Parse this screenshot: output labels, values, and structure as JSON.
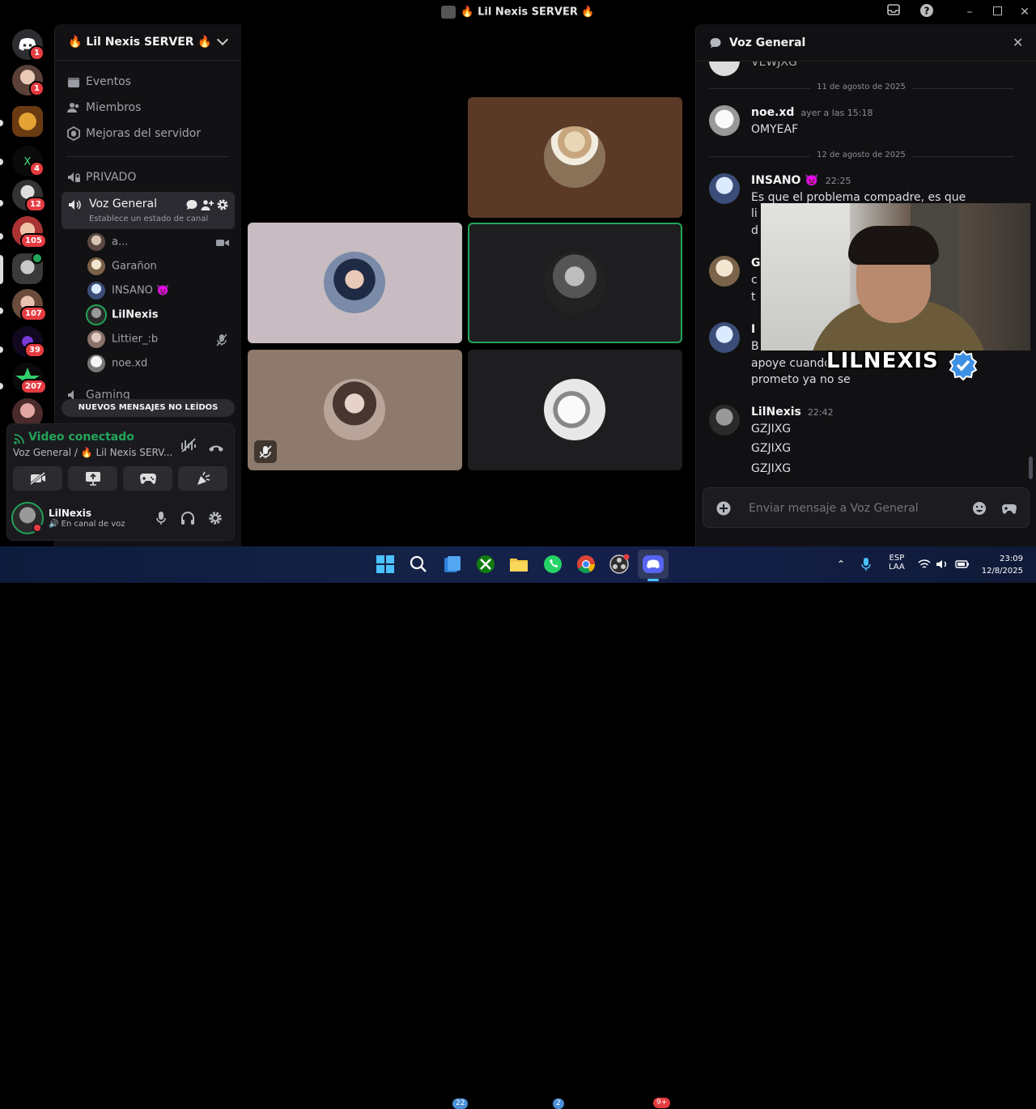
{
  "window": {
    "title": "🔥 Lil Nexis SERVER 🔥"
  },
  "rail": {
    "badges": [
      "1",
      "1",
      "4",
      "12",
      "105",
      "107",
      "39",
      "207"
    ]
  },
  "server": {
    "name": "🔥 Lil Nexis SERVER 🔥",
    "nav": [
      "Eventos",
      "Miembros",
      "Mejoras del servidor"
    ],
    "category": "PRIVADO",
    "voice_channel": {
      "name": "Voz General",
      "status": "Establece un estado de canal"
    },
    "members": [
      "a...",
      "Garañon",
      "INSANO 👿",
      "LilNexis",
      "Littier_:b",
      "noe.xd"
    ],
    "next_channel": "Gaming",
    "unread_banner": "NUEVOS MENSAJES NO LEÍDOS"
  },
  "voice": {
    "status": "Video conectado",
    "location": "Voz General / 🔥 Lil Nexis SERV..."
  },
  "user": {
    "name": "LilNexis",
    "status": "En canal de voz"
  },
  "chat": {
    "title": "Voz General",
    "truncated_top": "VEWJXG",
    "date1": "11 de agosto de 2025",
    "msg1": {
      "author": "noe.xd",
      "time": "ayer a las 15:18",
      "text": "OMYEAF"
    },
    "date2": "12 de agosto de 2025",
    "msg2": {
      "author": "INSANO 👿",
      "time": "22:25",
      "line1": "Es que el problema compadre, es que",
      "line2": "li",
      "line3": "d"
    },
    "msg3": {
      "author": "G",
      "line1": "c",
      "line2": "t"
    },
    "msg4": {
      "author": "I",
      "line1": "B",
      "line2": "apoye cuando",
      "line3": "prometo ya no se"
    },
    "msg5": {
      "author": "LilNexis",
      "time": "22:42",
      "lines": [
        "GZJIXG",
        "GZJIXG",
        "GZJIXG"
      ]
    },
    "input_placeholder": "Enviar mensaje a Voz General"
  },
  "overlay": {
    "name": "LILNEXIS"
  },
  "taskbar": {
    "badge_notes": "22",
    "badge_whatsapp": "2",
    "badge_discord": "9+",
    "lang1": "ESP",
    "lang2": "LAA",
    "time": "23:09",
    "date": "12/8/2025"
  },
  "colors": {
    "accent_green": "#23a55a",
    "badge_red": "#e43c41",
    "blurple": "#5865f2",
    "tile_brown": "#5a3a26",
    "tile_pink": "#c8bcc2",
    "tile_taupe": "#8e7a6c"
  }
}
